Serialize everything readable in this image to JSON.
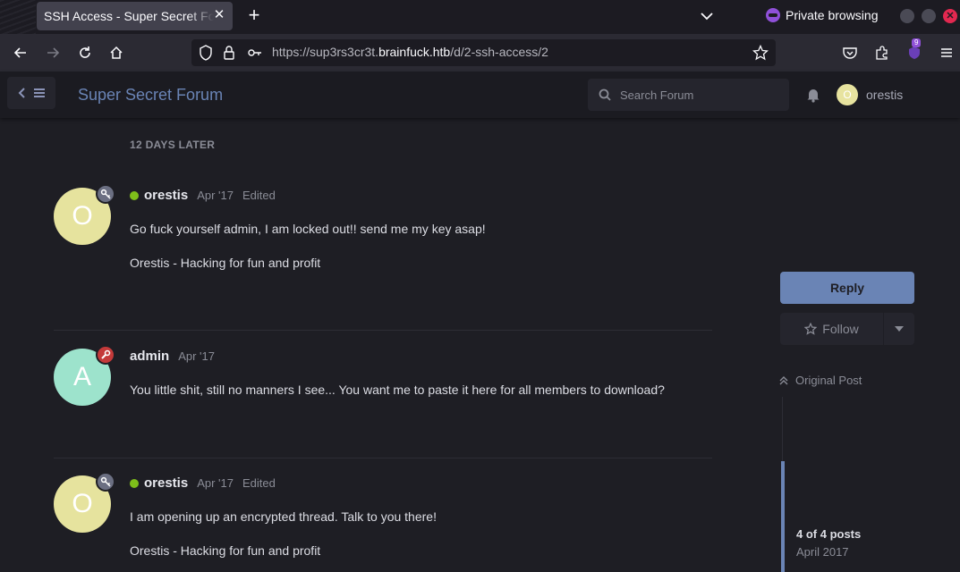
{
  "browser": {
    "tab_title": "SSH Access - Super Secret Forum",
    "url_prefix": "https://sup3rs3cr3t.",
    "url_host": "brainfuck.htb",
    "url_path": "/d/2-ssh-access/2",
    "private_label": "Private browsing",
    "extension_badge": "9"
  },
  "header": {
    "forum_title": "Super Secret Forum",
    "search_placeholder": "Search Forum",
    "user_initial": "O",
    "user_name": "orestis"
  },
  "separator": "12 DAYS LATER",
  "posts": [
    {
      "initial": "O",
      "avatar_color": "#e6e39e",
      "badge_color": "#6b6f82",
      "badge_icon": "key-icon",
      "online": true,
      "author": "orestis",
      "date": "Apr '17",
      "edited": "Edited",
      "lines": [
        "Go fuck yourself admin, I am locked out!! send me my key asap!",
        "Orestis - Hacking for fun and profit"
      ]
    },
    {
      "initial": "A",
      "avatar_color": "#9de3cc",
      "badge_color": "#c43a3a",
      "badge_icon": "wrench-icon",
      "online": false,
      "author": "admin",
      "date": "Apr '17",
      "edited": "",
      "lines": [
        "You little shit, still no manners I see... You want me to paste it here for all members to download?"
      ]
    },
    {
      "initial": "O",
      "avatar_color": "#e6e39e",
      "badge_color": "#6b6f82",
      "badge_icon": "key-icon",
      "online": true,
      "author": "orestis",
      "date": "Apr '17",
      "edited": "Edited",
      "lines": [
        "I am opening up an encrypted thread. Talk to you there!",
        "Orestis - Hacking for fun and profit"
      ]
    }
  ],
  "sidebar": {
    "reply_label": "Reply",
    "follow_label": "Follow",
    "original_post_label": "Original Post",
    "scrubber_count": "4 of 4 posts",
    "scrubber_date": "April 2017"
  },
  "colors": {
    "accent": "#6a84b5",
    "background": "#1e1e24",
    "online": "#7ebe1a"
  }
}
